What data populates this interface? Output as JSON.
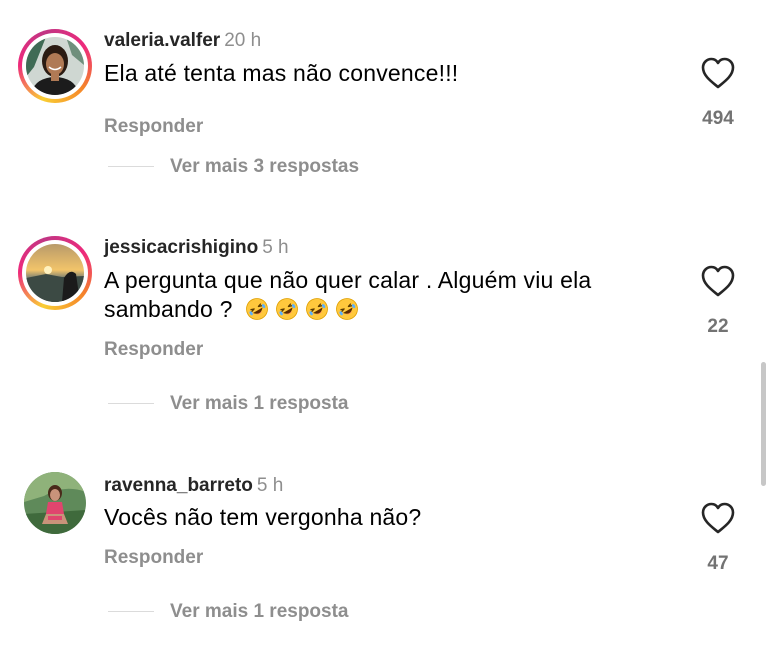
{
  "comments": [
    {
      "username": "valeria.valfer",
      "time": "20 h",
      "text": "Ela até tenta mas não convence!!!",
      "emojis": [],
      "reply_label": "Responder",
      "likes": "494",
      "more_replies": "Ver mais 3 respostas",
      "story_ring": true
    },
    {
      "username": "jessicacrishigino",
      "time": "5 h",
      "text": "A pergunta que não quer calar . Alguém viu ela sambando ?",
      "emojis": [
        "rolling-on-floor-laughing",
        "rolling-on-floor-laughing",
        "rolling-on-floor-laughing",
        "rolling-on-floor-laughing"
      ],
      "reply_label": "Responder",
      "likes": "22",
      "more_replies": "Ver mais 1 resposta",
      "story_ring": true
    },
    {
      "username": "ravenna_barreto",
      "time": "5 h",
      "text": "Vocês não tem vergonha não?",
      "emojis": [],
      "reply_label": "Responder",
      "likes": "47",
      "more_replies": "Ver mais 1 resposta",
      "story_ring": false
    }
  ],
  "colors": {
    "username": "#262626",
    "secondary_text": "#8e8e8e",
    "like_count": "#737373",
    "heart_outline": "#262626",
    "divider": "#dbdbdb",
    "emoji_face": "#ffc83d"
  },
  "icons": {
    "like": "heart-outline-icon",
    "emoji": "rolling-on-floor-laughing-emoji"
  }
}
